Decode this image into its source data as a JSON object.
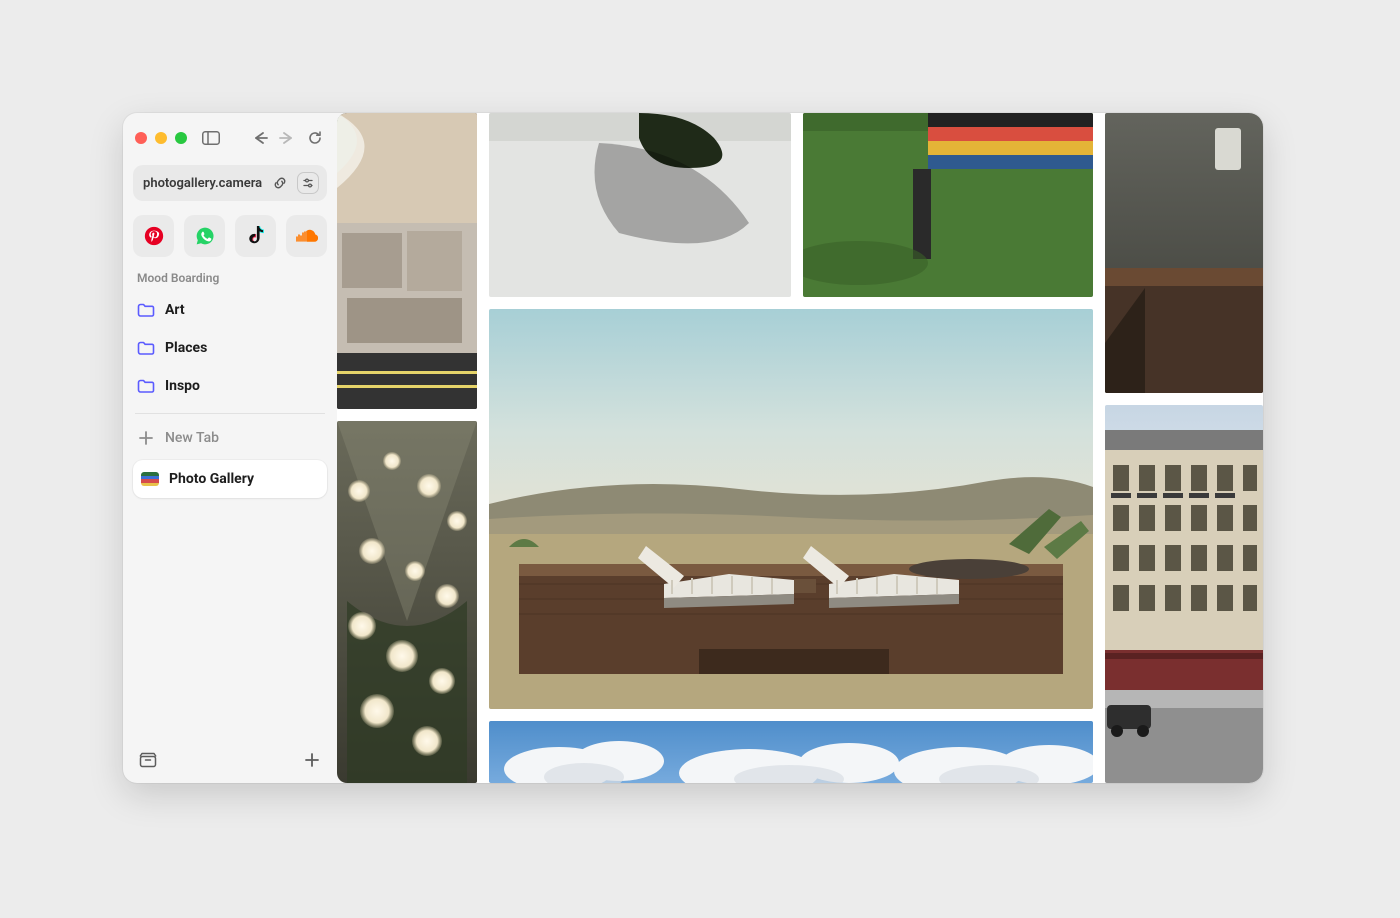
{
  "url": "photogallery.camera",
  "sidebar": {
    "section_title": "Mood Boarding",
    "folders": [
      {
        "label": "Art"
      },
      {
        "label": "Places"
      },
      {
        "label": "Inspo"
      }
    ],
    "new_tab_label": "New Tab",
    "active_tab_label": "Photo Gallery",
    "favorites": [
      {
        "name": "pinterest",
        "icon": "pinterest-icon"
      },
      {
        "name": "whatsapp",
        "icon": "whatsapp-icon"
      },
      {
        "name": "tiktok",
        "icon": "tiktok-icon"
      },
      {
        "name": "soundcloud",
        "icon": "soundcloud-icon"
      }
    ]
  },
  "colors": {
    "folder_accent": "#5b5bff",
    "pinterest": "#e60023",
    "whatsapp": "#25d366",
    "tiktok_cyan": "#25f4ee",
    "tiktok_pink": "#fe2c55",
    "soundcloud": "#ff7700"
  },
  "gallery_tiles": [
    "aerial-beach-road",
    "gravel-square-shadow",
    "grass-colorful-stripes",
    "dim-interior-shelf",
    "atrium-glass-orbs",
    "desert-loungers-deck",
    "paris-street-buildings",
    "blue-sky-clouds"
  ]
}
